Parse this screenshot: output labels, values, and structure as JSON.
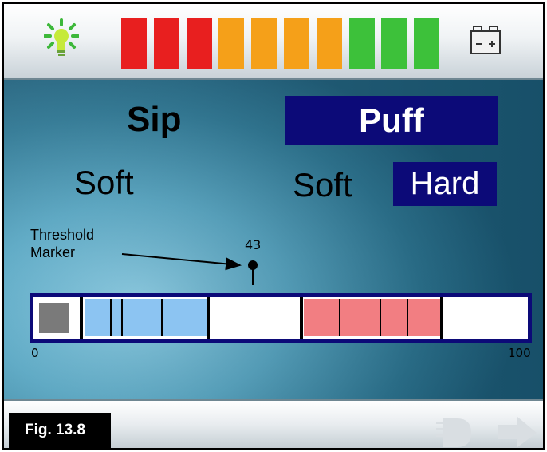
{
  "header": {
    "light_icon": "light-bulb-icon",
    "battery_icon": "battery-icon",
    "battery_level": {
      "segments_total": 10,
      "colors": [
        "#e81f1f",
        "#e81f1f",
        "#e81f1f",
        "#f5a019",
        "#f5a019",
        "#f5a019",
        "#f5a019",
        "#3dc13a",
        "#3dc13a",
        "#3dc13a"
      ]
    }
  },
  "modes": {
    "sip_label": "Sip",
    "puff_label": "Puff",
    "sip_soft_label": "Soft",
    "puff_soft_label": "Soft",
    "puff_hard_label": "Hard"
  },
  "threshold": {
    "label_line1": "Threshold",
    "label_line2": "Marker",
    "value": "43"
  },
  "scale": {
    "min_label": "0",
    "max_label": "100"
  },
  "footer": {
    "figure_label": "Fig. 13.8"
  },
  "colors": {
    "active_bg": "#0c0a78",
    "sip_zone": "#8cc4f2",
    "puff_zone": "#f27e82",
    "neutral_marker": "#7a7a7a"
  }
}
